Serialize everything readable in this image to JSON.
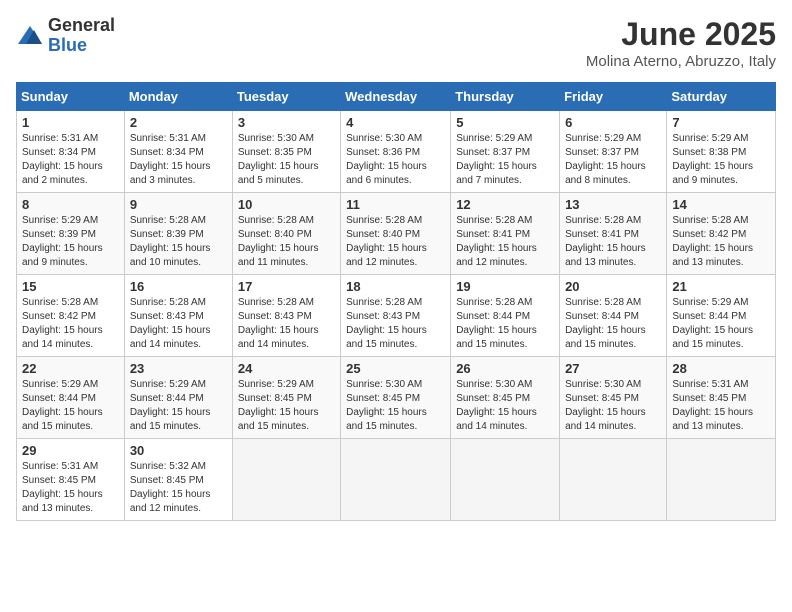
{
  "logo": {
    "general": "General",
    "blue": "Blue"
  },
  "title": "June 2025",
  "location": "Molina Aterno, Abruzzo, Italy",
  "headers": [
    "Sunday",
    "Monday",
    "Tuesday",
    "Wednesday",
    "Thursday",
    "Friday",
    "Saturday"
  ],
  "weeks": [
    [
      {
        "day": "1",
        "sunrise": "5:31 AM",
        "sunset": "8:34 PM",
        "daylight": "15 hours and 2 minutes."
      },
      {
        "day": "2",
        "sunrise": "5:31 AM",
        "sunset": "8:34 PM",
        "daylight": "15 hours and 3 minutes."
      },
      {
        "day": "3",
        "sunrise": "5:30 AM",
        "sunset": "8:35 PM",
        "daylight": "15 hours and 5 minutes."
      },
      {
        "day": "4",
        "sunrise": "5:30 AM",
        "sunset": "8:36 PM",
        "daylight": "15 hours and 6 minutes."
      },
      {
        "day": "5",
        "sunrise": "5:29 AM",
        "sunset": "8:37 PM",
        "daylight": "15 hours and 7 minutes."
      },
      {
        "day": "6",
        "sunrise": "5:29 AM",
        "sunset": "8:37 PM",
        "daylight": "15 hours and 8 minutes."
      },
      {
        "day": "7",
        "sunrise": "5:29 AM",
        "sunset": "8:38 PM",
        "daylight": "15 hours and 9 minutes."
      }
    ],
    [
      {
        "day": "8",
        "sunrise": "5:29 AM",
        "sunset": "8:39 PM",
        "daylight": "15 hours and 9 minutes."
      },
      {
        "day": "9",
        "sunrise": "5:28 AM",
        "sunset": "8:39 PM",
        "daylight": "15 hours and 10 minutes."
      },
      {
        "day": "10",
        "sunrise": "5:28 AM",
        "sunset": "8:40 PM",
        "daylight": "15 hours and 11 minutes."
      },
      {
        "day": "11",
        "sunrise": "5:28 AM",
        "sunset": "8:40 PM",
        "daylight": "15 hours and 12 minutes."
      },
      {
        "day": "12",
        "sunrise": "5:28 AM",
        "sunset": "8:41 PM",
        "daylight": "15 hours and 12 minutes."
      },
      {
        "day": "13",
        "sunrise": "5:28 AM",
        "sunset": "8:41 PM",
        "daylight": "15 hours and 13 minutes."
      },
      {
        "day": "14",
        "sunrise": "5:28 AM",
        "sunset": "8:42 PM",
        "daylight": "15 hours and 13 minutes."
      }
    ],
    [
      {
        "day": "15",
        "sunrise": "5:28 AM",
        "sunset": "8:42 PM",
        "daylight": "15 hours and 14 minutes."
      },
      {
        "day": "16",
        "sunrise": "5:28 AM",
        "sunset": "8:43 PM",
        "daylight": "15 hours and 14 minutes."
      },
      {
        "day": "17",
        "sunrise": "5:28 AM",
        "sunset": "8:43 PM",
        "daylight": "15 hours and 14 minutes."
      },
      {
        "day": "18",
        "sunrise": "5:28 AM",
        "sunset": "8:43 PM",
        "daylight": "15 hours and 15 minutes."
      },
      {
        "day": "19",
        "sunrise": "5:28 AM",
        "sunset": "8:44 PM",
        "daylight": "15 hours and 15 minutes."
      },
      {
        "day": "20",
        "sunrise": "5:28 AM",
        "sunset": "8:44 PM",
        "daylight": "15 hours and 15 minutes."
      },
      {
        "day": "21",
        "sunrise": "5:29 AM",
        "sunset": "8:44 PM",
        "daylight": "15 hours and 15 minutes."
      }
    ],
    [
      {
        "day": "22",
        "sunrise": "5:29 AM",
        "sunset": "8:44 PM",
        "daylight": "15 hours and 15 minutes."
      },
      {
        "day": "23",
        "sunrise": "5:29 AM",
        "sunset": "8:44 PM",
        "daylight": "15 hours and 15 minutes."
      },
      {
        "day": "24",
        "sunrise": "5:29 AM",
        "sunset": "8:45 PM",
        "daylight": "15 hours and 15 minutes."
      },
      {
        "day": "25",
        "sunrise": "5:30 AM",
        "sunset": "8:45 PM",
        "daylight": "15 hours and 15 minutes."
      },
      {
        "day": "26",
        "sunrise": "5:30 AM",
        "sunset": "8:45 PM",
        "daylight": "15 hours and 14 minutes."
      },
      {
        "day": "27",
        "sunrise": "5:30 AM",
        "sunset": "8:45 PM",
        "daylight": "15 hours and 14 minutes."
      },
      {
        "day": "28",
        "sunrise": "5:31 AM",
        "sunset": "8:45 PM",
        "daylight": "15 hours and 13 minutes."
      }
    ],
    [
      {
        "day": "29",
        "sunrise": "5:31 AM",
        "sunset": "8:45 PM",
        "daylight": "15 hours and 13 minutes."
      },
      {
        "day": "30",
        "sunrise": "5:32 AM",
        "sunset": "8:45 PM",
        "daylight": "15 hours and 12 minutes."
      },
      null,
      null,
      null,
      null,
      null
    ]
  ],
  "labels": {
    "sunrise": "Sunrise:",
    "sunset": "Sunset:",
    "daylight": "Daylight:"
  }
}
